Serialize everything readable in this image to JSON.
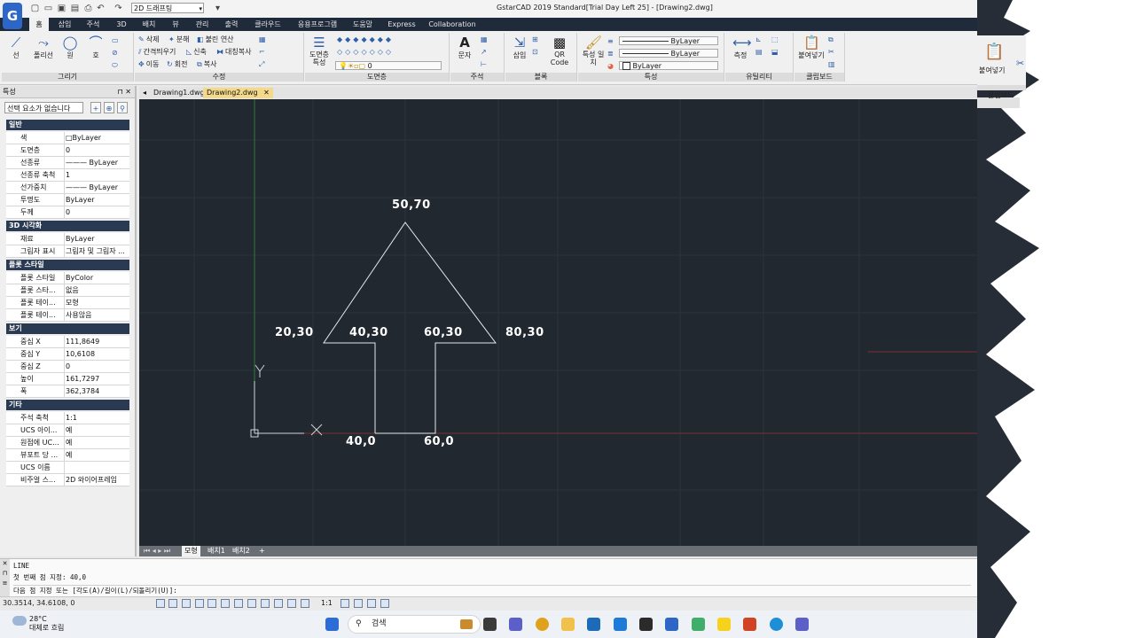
{
  "app": {
    "title": "GstarCAD 2019 Standard[Trial Day Left 25] - [Drawing2.dwg]",
    "logo_letter": "G",
    "workspace": "2D 드래프팅"
  },
  "tabs": [
    "홈",
    "삽입",
    "주석",
    "3D",
    "배치",
    "뷰",
    "관리",
    "출력",
    "클라우드",
    "응용프로그램",
    "도움말",
    "Express",
    "Collaboration"
  ],
  "ribbon": {
    "draw": {
      "label": "그리기",
      "line": "선",
      "polyline": "폴리선",
      "circle": "원",
      "arc": "호"
    },
    "modify": {
      "label": "수정",
      "items": [
        "삭제",
        "분해",
        "불린 연산",
        "간격띄우기",
        "신축",
        "대칭복사",
        "이동",
        "회전",
        "복사"
      ]
    },
    "layers": {
      "label": "도면층",
      "layer_props": "도면층 특성",
      "current_layer": "0"
    },
    "annotation": {
      "label": "주석",
      "text": "문자"
    },
    "block": {
      "label": "블록",
      "insert": "삽입",
      "qr": "QR Code"
    },
    "properties": {
      "label": "특성",
      "match": "특성 일치",
      "linetype": "ByLayer",
      "lineweight": "ByLayer",
      "color": "ByLayer"
    },
    "utilities": {
      "label": "유틸리티",
      "measure": "측정"
    },
    "clipboard": {
      "label": "클립보드",
      "paste": "붙여넣기"
    }
  },
  "properties_panel": {
    "title": "특성",
    "selection": "선택 요소가 없습니다",
    "sections": [
      {
        "name": "일반",
        "rows": [
          {
            "k": "색",
            "v": "□ByLayer"
          },
          {
            "k": "도면층",
            "v": "0"
          },
          {
            "k": "선종류",
            "v": "——— ByLayer"
          },
          {
            "k": "선종류 축척",
            "v": "1"
          },
          {
            "k": "선가중치",
            "v": "——— ByLayer"
          },
          {
            "k": "투명도",
            "v": "ByLayer"
          },
          {
            "k": "두께",
            "v": "0"
          }
        ]
      },
      {
        "name": "3D 시각화",
        "rows": [
          {
            "k": "재료",
            "v": "ByLayer"
          },
          {
            "k": "그림자 표시",
            "v": "그림자 및 그림자 ..."
          }
        ]
      },
      {
        "name": "플롯 스타일",
        "rows": [
          {
            "k": "플롯 스타일",
            "v": "ByColor"
          },
          {
            "k": "플롯 스타...",
            "v": "없음"
          },
          {
            "k": "플롯 테이...",
            "v": "모형"
          },
          {
            "k": "플롯 테이...",
            "v": "사용않음"
          }
        ]
      },
      {
        "name": "보기",
        "rows": [
          {
            "k": "중심 X",
            "v": "111,8649"
          },
          {
            "k": "중심 Y",
            "v": "10,6108"
          },
          {
            "k": "중심 Z",
            "v": "0"
          },
          {
            "k": "높이",
            "v": "161,7297"
          },
          {
            "k": "폭",
            "v": "362,3784"
          }
        ]
      },
      {
        "name": "기타",
        "rows": [
          {
            "k": "주석 축척",
            "v": "1:1"
          },
          {
            "k": "UCS 아이...",
            "v": "예"
          },
          {
            "k": "원점에 UC...",
            "v": "예"
          },
          {
            "k": "뷰포트 당 ...",
            "v": "예"
          },
          {
            "k": "UCS 이름",
            "v": ""
          },
          {
            "k": "비주얼 스...",
            "v": "2D 와이어프레임"
          }
        ]
      }
    ]
  },
  "documents": [
    "Drawing1.dwg",
    "Drawing2.dwg"
  ],
  "drawing": {
    "labels": [
      "50,70",
      "20,30",
      "40,30",
      "60,30",
      "80,30",
      "40,0",
      "60,0"
    ],
    "ucs": {
      "x": "X",
      "y": "Y"
    }
  },
  "layout_tabs": [
    "모형",
    "배치1",
    "배치2",
    "+"
  ],
  "command": {
    "lines": [
      "LINE",
      "첫 번째 점 지정:  40,0",
      "다음 점 지정 또는 [각도(A)/길이(L)/되돌리기(U)]:"
    ]
  },
  "status": {
    "coords": "30.3514, 34.6108, 0",
    "scale": "1:1"
  },
  "taskbar": {
    "temperature": "28°C",
    "weather": "대체로 흐림",
    "search": "검색"
  },
  "colors": {
    "canvas": "#212830",
    "section": "#2a3a53",
    "ribbon_tabs": "#1f2b3a",
    "active_doc": "#f5d98a",
    "y_axis": "#2f7a3a",
    "x_axis": "#7a2f2f"
  }
}
